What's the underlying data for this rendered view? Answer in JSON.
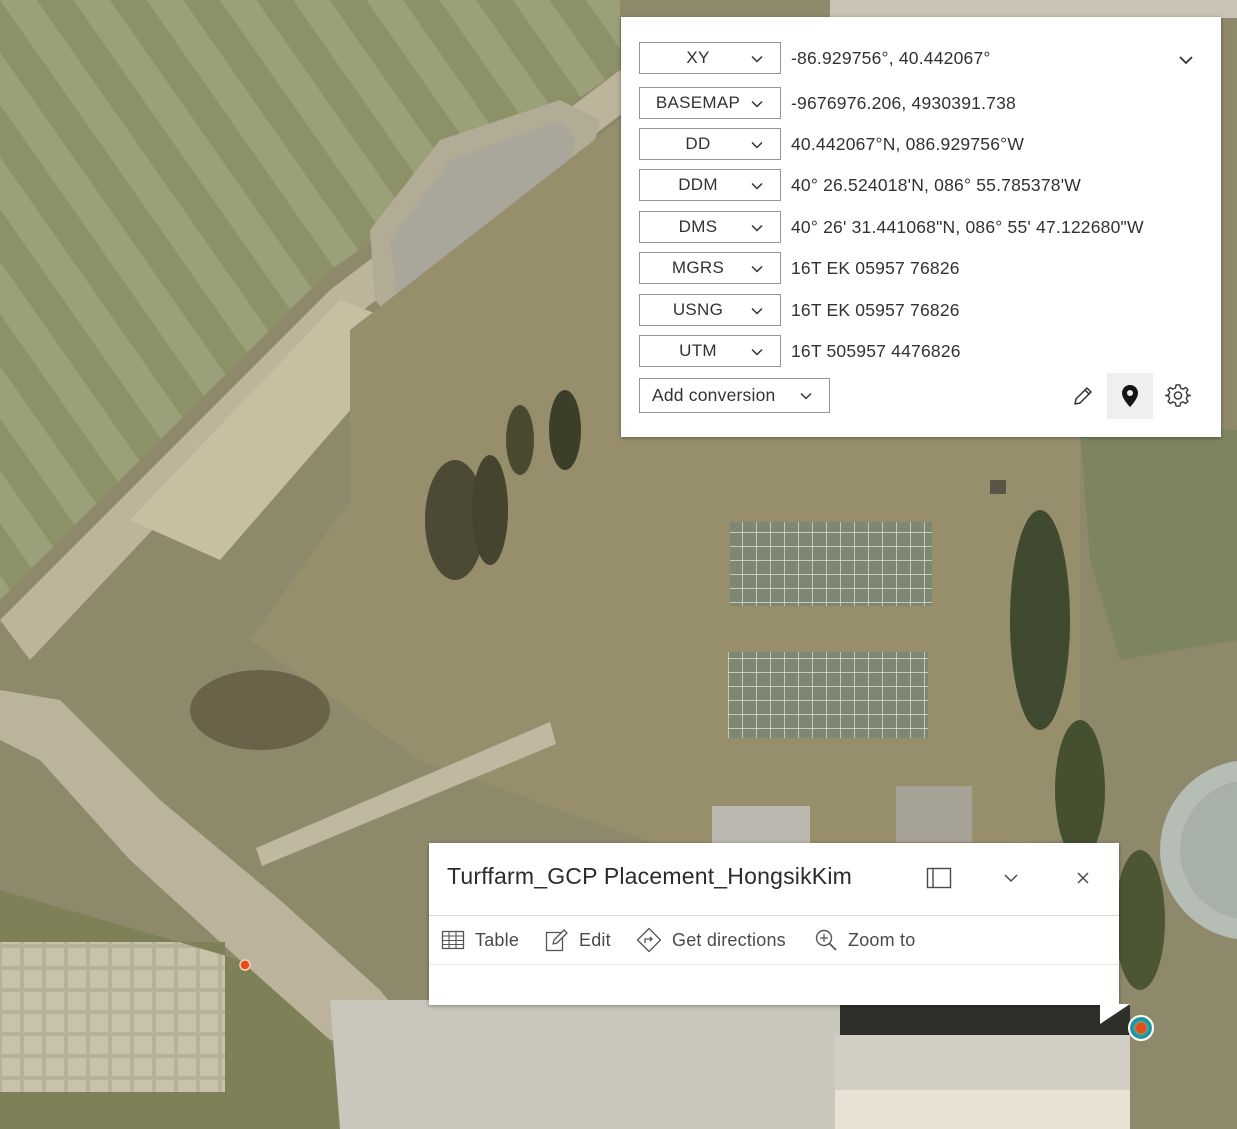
{
  "colors": {
    "panel_bg": "#ffffff",
    "border": "#959595",
    "text": "#323232",
    "gcp_marker": "#e8491d",
    "selection_ring": "#00a0b0"
  },
  "coordinate_panel": {
    "expand_icon": "chevron-down-icon",
    "rows": [
      {
        "format": "XY",
        "value": "-86.929756°, 40.442067°"
      },
      {
        "format": "BASEMAP",
        "value": "-9676976.206, 4930391.738"
      },
      {
        "format": "DD",
        "value": "40.442067°N, 086.929756°W"
      },
      {
        "format": "DDM",
        "value": "40° 26.524018'N, 086° 55.785378'W"
      },
      {
        "format": "DMS",
        "value": "40° 26' 31.441068\"N, 086° 55' 47.122680\"W"
      },
      {
        "format": "MGRS",
        "value": "16T EK 05957 76826"
      },
      {
        "format": "USNG",
        "value": "16T EK 05957 76826"
      },
      {
        "format": "UTM",
        "value": "16T 505957 4476826"
      }
    ],
    "add_conversion_label": "Add conversion",
    "tools": [
      "pencil-icon",
      "map-pin-icon",
      "gear-icon"
    ]
  },
  "popup": {
    "title": "Turffarm_GCP Placement_HongsikKim",
    "actions": [
      {
        "label": "Table",
        "icon": "table-icon"
      },
      {
        "label": "Edit",
        "icon": "edit-icon"
      },
      {
        "label": "Get directions",
        "icon": "directions-icon"
      },
      {
        "label": "Zoom to",
        "icon": "zoom-to-icon"
      }
    ]
  }
}
